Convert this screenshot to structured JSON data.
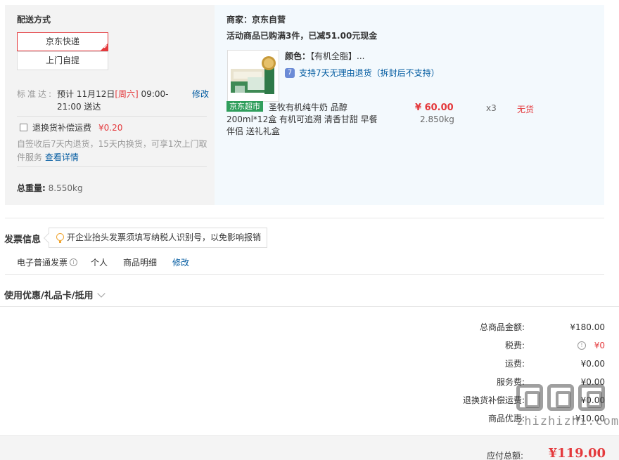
{
  "delivery": {
    "title": "配送方式",
    "options": [
      "京东快递",
      "上门自提"
    ],
    "eta_label": "标准达:",
    "eta_prefix": "预计 11月12日",
    "eta_weekday": "[周六]",
    "eta_suffix": " 09:00-21:00 送达",
    "modify": "修改",
    "insurance_label": "退换货补偿运费",
    "insurance_fee": "¥0.20",
    "insurance_note": "自签收后7天内退货，15天内换货，可享1次上门取件服务",
    "insurance_link": "查看详情",
    "weight_label": "总重量:",
    "weight_value": "8.550kg"
  },
  "merchant": {
    "line1": "商家：京东自营",
    "line2": "活动商品已购满3件，已减51.00元现金",
    "badge": "京东超市",
    "product_name": "圣牧有机纯牛奶 品醇200ml*12盒 有机可追溯 清香甘甜 早餐伴侣 送礼礼盒",
    "color_label": "颜色：",
    "color_value": "【有机全脂】...",
    "returns": "支持7天无理由退货（拆封后不支持）",
    "returns_icon_glyph": "7",
    "price": "¥ 60.00",
    "qty": "x3",
    "stock": "无货",
    "item_weight": "2.850kg"
  },
  "invoice": {
    "title": "发票信息",
    "tip": "开企业抬头发票须填写纳税人识别号，以免影响报销",
    "type": "电子普通发票",
    "info_glyph": "i",
    "person": "个人",
    "detail": "商品明细",
    "modify": "修改"
  },
  "coupon": {
    "title": "使用优惠/礼品卡/抵用"
  },
  "summary": {
    "rows": [
      {
        "label": "总商品金额:",
        "value": "¥180.00"
      },
      {
        "label": "税费:",
        "value": "¥0"
      },
      {
        "label": "运费:",
        "value": "¥0.00"
      },
      {
        "label": "服务费:",
        "value": "¥0.00"
      },
      {
        "label": "退换货补偿运费:",
        "value": "¥0.00"
      },
      {
        "label": "商品优惠:",
        "value": "-¥10.00"
      }
    ],
    "tax_info_glyph": "!",
    "total_label": "应付总额:",
    "total_value": "¥119.00"
  },
  "watermark": {
    "text": "zhizhizhi.com"
  },
  "colors": {
    "accent": "#e4393c",
    "link": "#005aa0",
    "badge": "#2f9e5c",
    "merchant_bg": "#f3f9fd"
  }
}
